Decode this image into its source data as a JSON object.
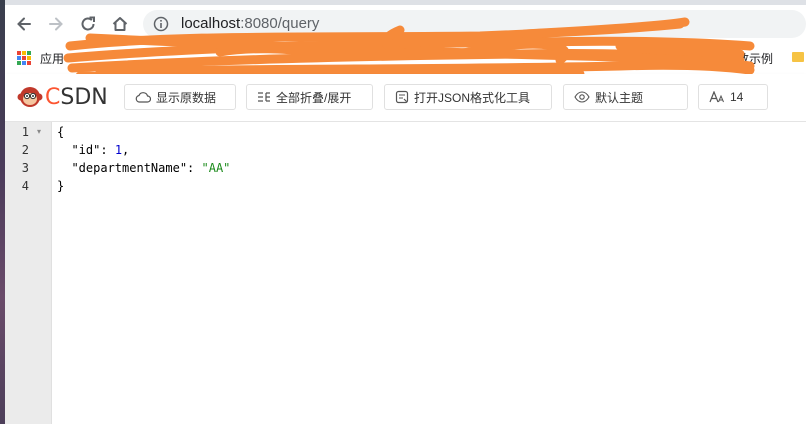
{
  "browser": {
    "url_host": "localhost",
    "url_rest": ":8080/query",
    "bookmarks": {
      "apps_label": "应用",
      "right_label": "前数示例"
    }
  },
  "toolbar": {
    "logo_text_c": "C",
    "logo_text_rest": "SDN",
    "raw_data_label": "显示原数据",
    "fold_label": "全部折叠/展开",
    "open_tool_label": "打开JSON格式化工具",
    "theme_label": "默认主题",
    "font_size_label": "14"
  },
  "editor": {
    "line_numbers": [
      "1",
      "2",
      "3",
      "4"
    ],
    "lines": [
      {
        "text": "{"
      },
      {
        "key": "\"id\"",
        "sep": ": ",
        "value": "1",
        "value_type": "num",
        "trail": ","
      },
      {
        "key": "\"departmentName\"",
        "sep": ": ",
        "value": "\"AA\"",
        "value_type": "str",
        "trail": ""
      },
      {
        "text": "}"
      }
    ]
  },
  "colors": {
    "csdn_red": "#fc5531",
    "scribble": "#f68a3a",
    "number": "#0000cd",
    "string": "#1a8a1a"
  }
}
